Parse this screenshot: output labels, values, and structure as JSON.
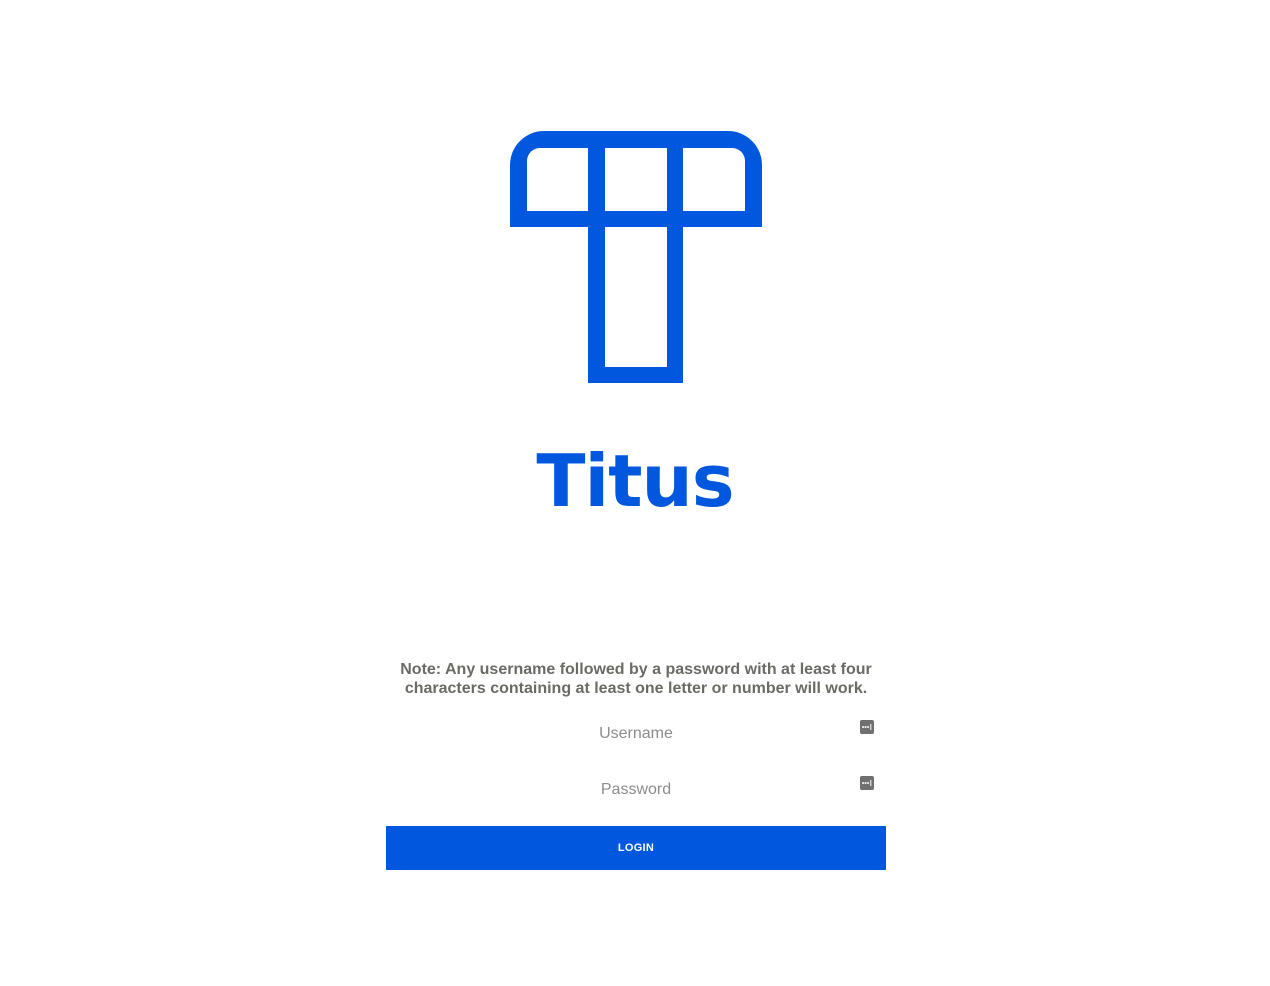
{
  "brand": {
    "name": "Titus",
    "logo_icon": "titus-t-logo",
    "color": "#0158df"
  },
  "login": {
    "note": "Note: Any username followed by a password with at least four characters containing at least one letter or number will work.",
    "username": {
      "placeholder": "Username",
      "value": "",
      "icon": "password-manager-key-icon"
    },
    "password": {
      "placeholder": "Password",
      "value": "",
      "icon": "password-manager-key-icon"
    },
    "submit_label": "LOGIN",
    "button_color": "#0158df",
    "note_color": "#6b6b66"
  }
}
